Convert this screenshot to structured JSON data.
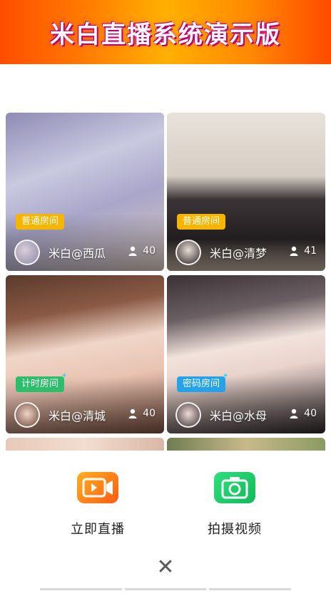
{
  "banner": {
    "title": "米白直播系统演示版"
  },
  "rooms": [
    {
      "tag": "普通房间",
      "tag_color": "#f7b500",
      "user": "米白@西瓜",
      "viewers": "40",
      "bg": "#b9b8d6"
    },
    {
      "tag": "普通房间",
      "tag_color": "#f7b500",
      "user": "米白@清梦",
      "viewers": "41",
      "bg": "#dcd6cf"
    },
    {
      "tag": "计时房间",
      "tag_color": "#2ebd6b",
      "user": "米白@清城",
      "viewers": "40",
      "bg": "#9c6a55"
    },
    {
      "tag": "密码房间",
      "tag_color": "#26a3e8",
      "user": "米白@水母",
      "viewers": "40",
      "bg": "#b8b2b6"
    }
  ],
  "sheet": {
    "live_label": "立即直播",
    "live_icon": "video-camera-icon",
    "live_color": "#ff6a14",
    "video_label": "拍摄视频",
    "video_icon": "camera-icon",
    "video_color": "#16c464",
    "close_icon": "close-icon"
  }
}
